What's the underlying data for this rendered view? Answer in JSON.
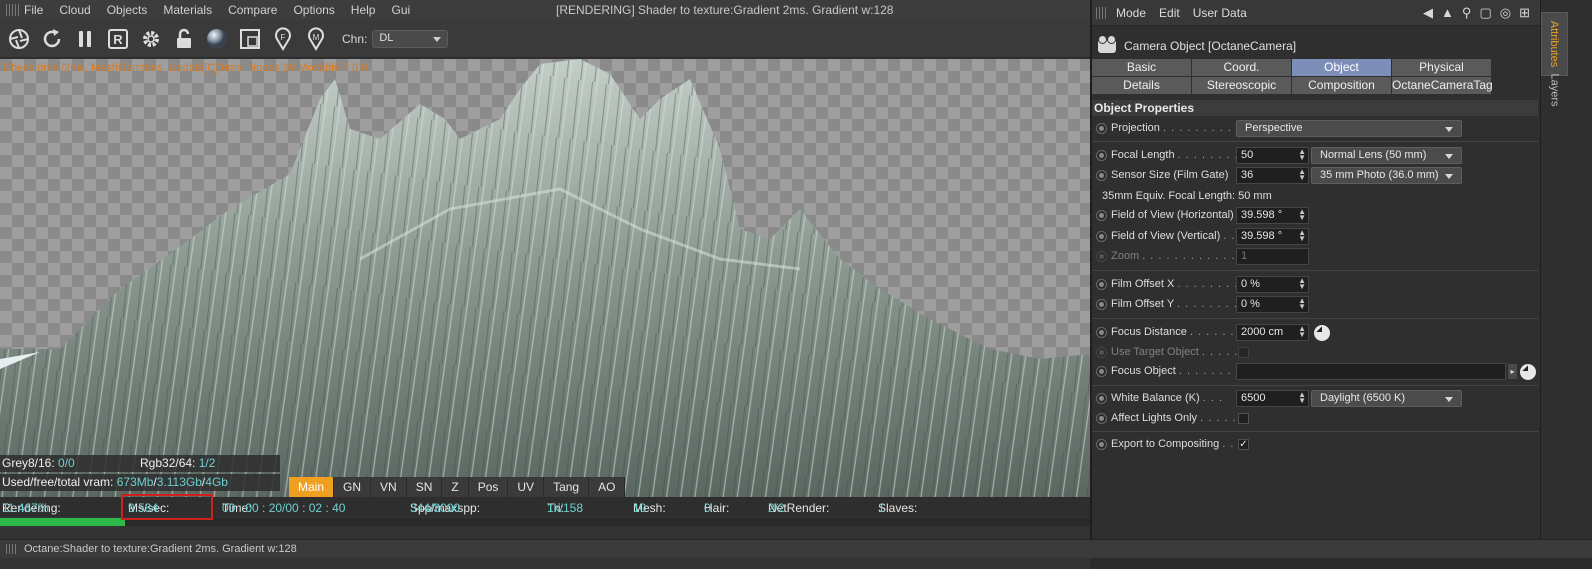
{
  "viewer": {
    "menu": [
      "File",
      "Cloud",
      "Objects",
      "Materials",
      "Compare",
      "Options",
      "Help",
      "Gui"
    ],
    "title": "[RENDERING] Shader to texture:Gradient  2ms. Gradient w:128",
    "toolbar_icons": [
      "aperture-icon",
      "refresh-icon",
      "pause-icon",
      "r-icon",
      "gear-icon",
      "lock-icon",
      "material-ball-icon",
      "region-icon",
      "focus-pin-icon",
      "material-pin-icon"
    ],
    "channel_label": "Chn:",
    "channel_value": "DL",
    "stats_line": "Check:0ms./2ms. MeshGen:0ms. Update[C]:0ms. Nodes:39 Movable:7  0 0",
    "grey_label": "Grey8/16: ",
    "grey_value": "0/0",
    "rgb_label": "Rgb32/64: ",
    "rgb_value": "1/2",
    "vram_label": "Used/free/total vram: ",
    "vram_used": "673Mb",
    "vram_free": "3.113Gb",
    "vram_total": "4Gb",
    "passes": [
      "Main",
      "GN",
      "VN",
      "SN",
      "Z",
      "Pos",
      "UV",
      "Tang",
      "AO"
    ],
    "active_pass": "Main",
    "status": {
      "rendering_label": "Rendering: ",
      "rendering_value": "11.467%",
      "mssec_label": "Ms/sec: ",
      "mssec_value": "9.584",
      "time_label": "Time: ",
      "time_value": "00 : 00 : 20/00 : 02 : 40",
      "spp_label": "Spp/maxspp: ",
      "spp_value": "344/3000",
      "tri_label": "Tri: ",
      "tri_value": "1k/158",
      "mesh_label": "Mesh: ",
      "mesh_value": "10",
      "hair_label": "Hair: ",
      "hair_value": "0",
      "netrender_label": "NetRender: ",
      "netrender_value": "2/2",
      "slaves_label": "Slaves: ",
      "slaves_value": "1"
    },
    "progress": 0.11467,
    "footer": "Octane:Shader to texture:Gradient  2ms. Gradient w:128",
    "colors": {
      "accent": "#f0a020",
      "progress": "#2eb84a",
      "stat_value": "#6fd0d0",
      "stats_line": "#d97a1e",
      "highlight_box": "#d02020"
    }
  },
  "attributes": {
    "menu": [
      "Mode",
      "Edit",
      "User Data"
    ],
    "object_title": "Camera Object [OctaneCamera]",
    "tabs": [
      "Basic",
      "Coord.",
      "Object",
      "Physical",
      "Details",
      "Stereoscopic",
      "Composition",
      "OctaneCameraTag"
    ],
    "active_tab": "Object",
    "section": "Object Properties",
    "projection": {
      "label": "Projection",
      "value": "Perspective"
    },
    "focal_length": {
      "label": "Focal Length",
      "value": "50",
      "preset": "Normal Lens (50 mm)"
    },
    "sensor_size": {
      "label": "Sensor Size (Film Gate)",
      "value": "36",
      "preset": "35 mm Photo (36.0 mm)"
    },
    "equiv_focal": "35mm Equiv. Focal Length: 50 mm",
    "fov_h": {
      "label": "Field of View (Horizontal)",
      "value": "39.598 °"
    },
    "fov_v": {
      "label": "Field of View (Vertical)",
      "value": "39.598 °"
    },
    "zoom": {
      "label": "Zoom",
      "value": "1"
    },
    "film_offset_x": {
      "label": "Film Offset X",
      "value": "0 %"
    },
    "film_offset_y": {
      "label": "Film Offset Y",
      "value": "0 %"
    },
    "focus_distance": {
      "label": "Focus Distance",
      "value": "2000 cm"
    },
    "use_target": {
      "label": "Use Target Object"
    },
    "focus_object": {
      "label": "Focus Object",
      "value": ""
    },
    "white_balance": {
      "label": "White Balance (K)",
      "value": "6500",
      "preset": "Daylight (6500 K)"
    },
    "affect_lights": {
      "label": "Affect Lights Only"
    },
    "export_compositing": {
      "label": "Export to Compositing",
      "checked": "✓"
    }
  },
  "side_tabs": [
    "Attributes",
    "Layers"
  ]
}
